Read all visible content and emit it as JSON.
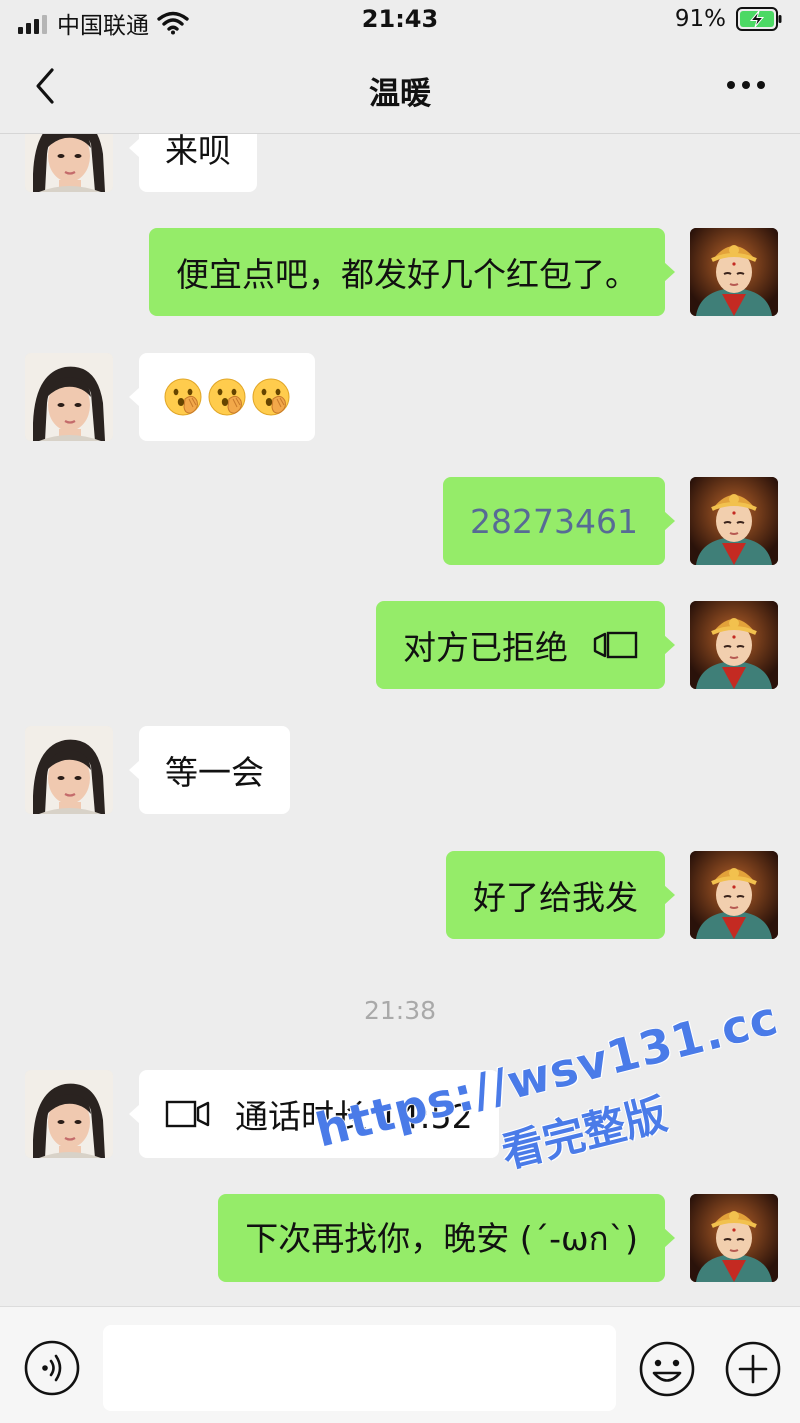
{
  "status_bar": {
    "carrier": "中国联通",
    "time": "21:43",
    "battery": "91%"
  },
  "header": {
    "title": "温暖"
  },
  "messages": [
    {
      "side": "in",
      "text": "来呗"
    },
    {
      "side": "out",
      "text": "便宜点吧，都发好几个红包了。"
    },
    {
      "side": "in",
      "emoji_count": 3,
      "emoji_name": "hand-over-mouth-emoji"
    },
    {
      "side": "out",
      "text": "28273461"
    },
    {
      "side": "out",
      "text": "对方已拒绝"
    },
    {
      "side": "in",
      "text": "等一会"
    },
    {
      "side": "out",
      "text": "好了给我发"
    },
    {
      "side": "in",
      "text": "通话时长 14:52"
    },
    {
      "side": "out",
      "text": "下次再找你，晚安 (´-ωก`)"
    }
  ],
  "timestamp": "21:38",
  "watermark": {
    "url": "https://wsv131.cc",
    "sub": "看完整版"
  },
  "colors": {
    "background": "#ededed",
    "outgoing_bubble": "#95ec69",
    "incoming_bubble": "#ffffff",
    "link_number": "#576b95",
    "watermark": "#4a7be8"
  }
}
